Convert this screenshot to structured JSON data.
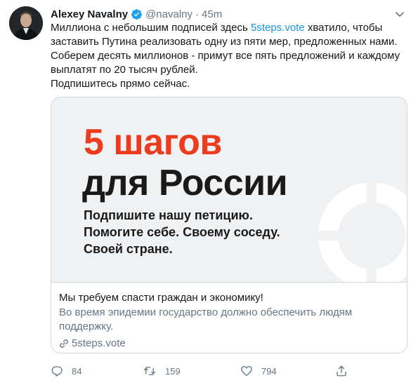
{
  "tweet": {
    "author_name": "Alexey Navalny",
    "handle": "@navalny",
    "separator": "·",
    "time": "45m",
    "text_lines": [
      {
        "before": "Миллиона с небольшим подписей здесь ",
        "link": "5steps.vote",
        "after": " хватило, чтобы"
      },
      "заставить Путина реализовать одну из пяти мер, предложенных нами.",
      "Соберем десять миллионов - примут все пять предложений и каждому",
      "выплатят по 20 тысяч рублей.",
      "Подпишитесь прямо сейчас."
    ]
  },
  "card": {
    "image": {
      "headline_red": "5 шагов",
      "headline_black": "для России",
      "lines": [
        "Подпишите нашу петицию.",
        "Помогите себе. Своему соседу.",
        "Своей стране."
      ]
    },
    "title": "Мы требуем спасти граждан и экономику!",
    "description_lines": [
      "Во время эпидемии государство должно обеспечить людям",
      "поддержку."
    ],
    "url": "5steps.vote"
  },
  "actions": {
    "reply_count": "84",
    "retweet_count": "159",
    "like_count": "794"
  },
  "colors": {
    "link": "#1b95e0",
    "accent_red": "#ec3b1d",
    "muted": "#657786"
  },
  "icons": [
    "verified-badge-icon",
    "chevron-down-icon",
    "reply-icon",
    "retweet-icon",
    "like-icon",
    "share-icon",
    "link-icon"
  ]
}
